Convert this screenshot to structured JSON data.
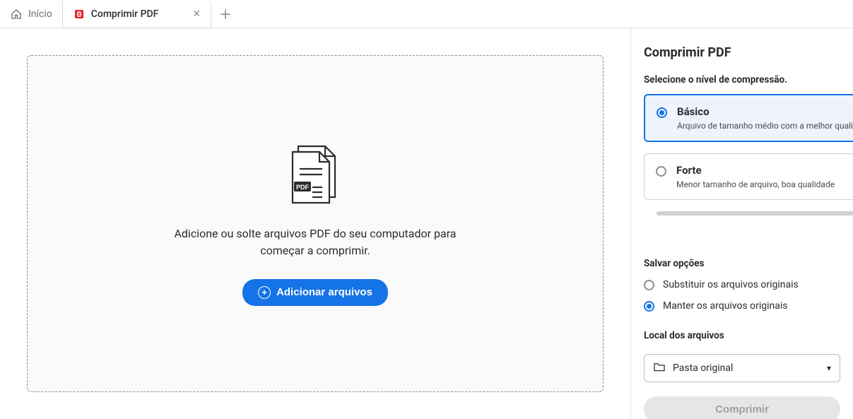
{
  "tabs": {
    "home": "Início",
    "active": "Comprimir PDF"
  },
  "dropzone": {
    "text": "Adicione ou solte arquivos PDF do seu computador para começar a comprimir.",
    "button": "Adicionar arquivos"
  },
  "panel": {
    "title": "Comprimir PDF",
    "subtitle": "Selecione o nível de compressão.",
    "options": [
      {
        "title": "Básico",
        "desc": "Arquivo de tamanho médio com a melhor qualidade"
      },
      {
        "title": "Forte",
        "desc": "Menor tamanho de arquivo, boa qualidade"
      }
    ],
    "save_section": "Salvar opções",
    "save_options": [
      "Substituir os arquivos originais",
      "Manter os arquivos originais"
    ],
    "location_label": "Local dos arquivos",
    "location_value": "Pasta original",
    "submit": "Comprimir"
  }
}
